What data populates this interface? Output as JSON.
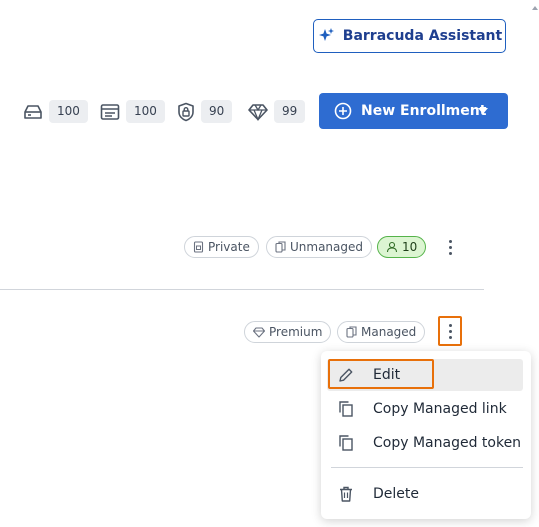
{
  "header": {
    "assistant_label": "Barracuda Assistant"
  },
  "counters": [
    {
      "icon": "inbox-tray-icon",
      "value": "100"
    },
    {
      "icon": "card-list-icon",
      "value": "100"
    },
    {
      "icon": "shield-lock-icon",
      "value": "90"
    },
    {
      "icon": "diamond-icon",
      "value": "99"
    }
  ],
  "enroll_button": {
    "label": "New Enrollment"
  },
  "row1": {
    "privacy": "Private",
    "management": "Unmanaged",
    "user_count": "10"
  },
  "row2": {
    "tier": "Premium",
    "management": "Managed"
  },
  "context_menu": {
    "items": [
      {
        "label": "Edit",
        "icon": "pencil-icon"
      },
      {
        "label": "Copy Managed link",
        "icon": "copy-icon"
      },
      {
        "label": "Copy Managed token",
        "icon": "copy-icon"
      },
      {
        "label": "Delete",
        "icon": "trash-icon"
      }
    ]
  },
  "colors": {
    "accent": "#2e6cd1",
    "highlight": "#e8700a",
    "success_bg": "#dcf5d2",
    "success_border": "#55b34a"
  }
}
